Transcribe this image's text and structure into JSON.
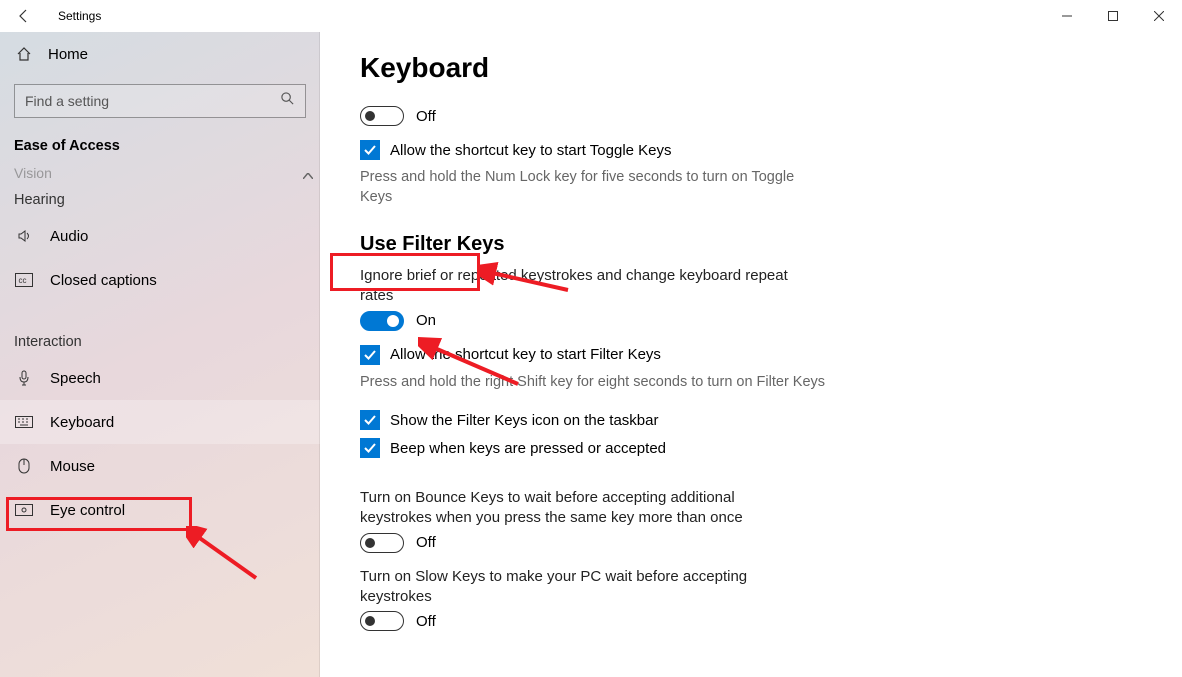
{
  "window": {
    "title": "Settings"
  },
  "sidebar": {
    "home_label": "Home",
    "search_placeholder": "Find a setting",
    "section": "Ease of Access",
    "partial_top_item": "Vision",
    "categories": {
      "hearing": "Hearing",
      "interaction": "Interaction"
    },
    "items": {
      "audio": "Audio",
      "closed_captions": "Closed captions",
      "speech": "Speech",
      "keyboard": "Keyboard",
      "mouse": "Mouse",
      "eye_control": "Eye control"
    }
  },
  "page": {
    "title": "Keyboard",
    "toggle_off_1": "Off",
    "cb_toggle_keys_shortcut": "Allow the shortcut key to start Toggle Keys",
    "toggle_keys_desc": "Press and hold the Num Lock key for five seconds to turn on Toggle Keys",
    "filter_keys_heading": "Use Filter Keys",
    "filter_keys_desc": "Ignore brief or repeated keystrokes and change keyboard repeat rates",
    "toggle_on": "On",
    "cb_filter_shortcut": "Allow the shortcut key to start Filter Keys",
    "filter_shortcut_desc": "Press and hold the right Shift key for eight seconds to turn on Filter Keys",
    "cb_show_icon": "Show the Filter Keys icon on the taskbar",
    "cb_beep": "Beep when keys are pressed or accepted",
    "bounce_desc": "Turn on Bounce Keys to wait before accepting additional keystrokes when you press the same key more than once",
    "toggle_off_2": "Off",
    "slow_desc": "Turn on Slow Keys to make your PC wait before accepting keystrokes",
    "toggle_off_3": "Off"
  },
  "annotations": {
    "highlight_keyboard_sidebar": true,
    "highlight_filter_keys_heading": true,
    "arrow_to_filter_toggle": true
  }
}
